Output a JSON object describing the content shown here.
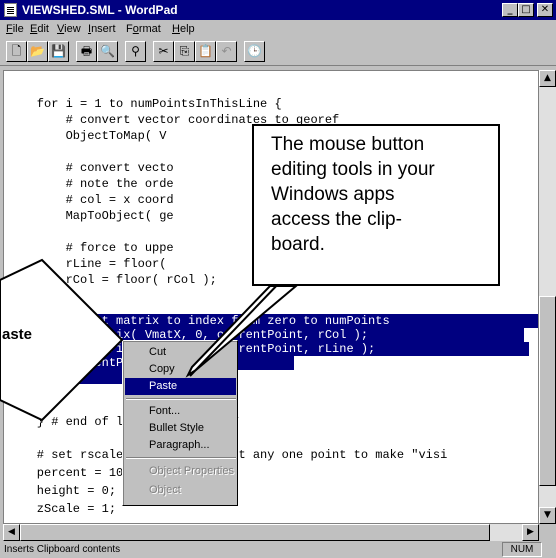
{
  "window": {
    "title": "VIEWSHED.SML - WordPad",
    "min_glyph": "_",
    "max_glyph": "□",
    "close_glyph": "✕"
  },
  "menu": {
    "items": [
      {
        "label": "File",
        "mnemonic": "F",
        "rest": "ile"
      },
      {
        "label": "Edit",
        "mnemonic": "E",
        "rest": "dit"
      },
      {
        "label": "View",
        "mnemonic": "V",
        "rest": "iew"
      },
      {
        "label": "Insert",
        "mnemonic": "I",
        "rest": "nsert"
      },
      {
        "label": "Format",
        "mnemonic": "o",
        "pre": "F",
        "rest": "rmat"
      },
      {
        "label": "Help",
        "mnemonic": "H",
        "rest": "elp"
      }
    ]
  },
  "toolbar": {
    "buttons": [
      {
        "name": "new-document-icon",
        "glyph": "🗋"
      },
      {
        "name": "open-folder-icon",
        "glyph": "📂"
      },
      {
        "name": "save-disk-icon",
        "glyph": "💾"
      },
      {
        "name": "print-icon",
        "glyph": "🖶"
      },
      {
        "name": "print-preview-icon",
        "glyph": "🔍"
      },
      {
        "name": "find-binoculars-icon",
        "glyph": "⚲"
      },
      {
        "name": "cut-scissors-icon",
        "glyph": "✂"
      },
      {
        "name": "copy-icon",
        "glyph": "⎘"
      },
      {
        "name": "paste-clipboard-icon",
        "glyph": "📋"
      },
      {
        "name": "undo-icon",
        "glyph": "↶"
      },
      {
        "name": "insert-datetime-icon",
        "glyph": "🕒"
      }
    ]
  },
  "code": {
    "lines": [
      "    for i = 1 to numPointsInThisLine {",
      "        # convert vector coordinates to georef",
      "        ObjectToMap( V                            , xV",
      "",
      "        # convert vecto                          nate",
      "        # note the orde",
      "        # col = x coord",
      "        MapToObject( ge                          rCol",
      "",
      "        # force to uppe",
      "        rLine = floor(",
      "        rCol = floor( rCol );",
      "",
      "        # want matrix to index from zero to numPoints",
      "        SetMatrix( VmatX, 0, currentPoint, rCol );",
      "        SetMatrix( VmatY, 0, currentPoint, rLine );",
      "        currentPoint +=1;",
      "        }",
      "",
      "    } # end of loop on line in V",
      "",
      "    # set rscale so we don't want any one point to make \"visi",
      "    percent = 100/numPoints;",
      "    height = 0;",
      "    zScale = 1;"
    ]
  },
  "context_menu": {
    "items": [
      {
        "label": "Cut",
        "state": "normal"
      },
      {
        "label": "Copy",
        "state": "normal"
      },
      {
        "label": "Paste",
        "state": "highlighted"
      },
      {
        "label": "Font...",
        "state": "normal"
      },
      {
        "label": "Bullet Style",
        "state": "normal"
      },
      {
        "label": "Paragraph...",
        "state": "normal"
      },
      {
        "label": "Object Properties",
        "state": "disabled"
      },
      {
        "label": "Object",
        "state": "disabled"
      }
    ]
  },
  "callout": {
    "text": "The mouse button\nediting tools in your\nWindows apps\naccess the clip-\nboard."
  },
  "arrow_label": "aste",
  "status": {
    "message": "Inserts Clipboard contents",
    "num": "NUM"
  },
  "colors": {
    "title_bar": "#000080",
    "selection": "#000080",
    "chrome": "#c0c0c0"
  }
}
